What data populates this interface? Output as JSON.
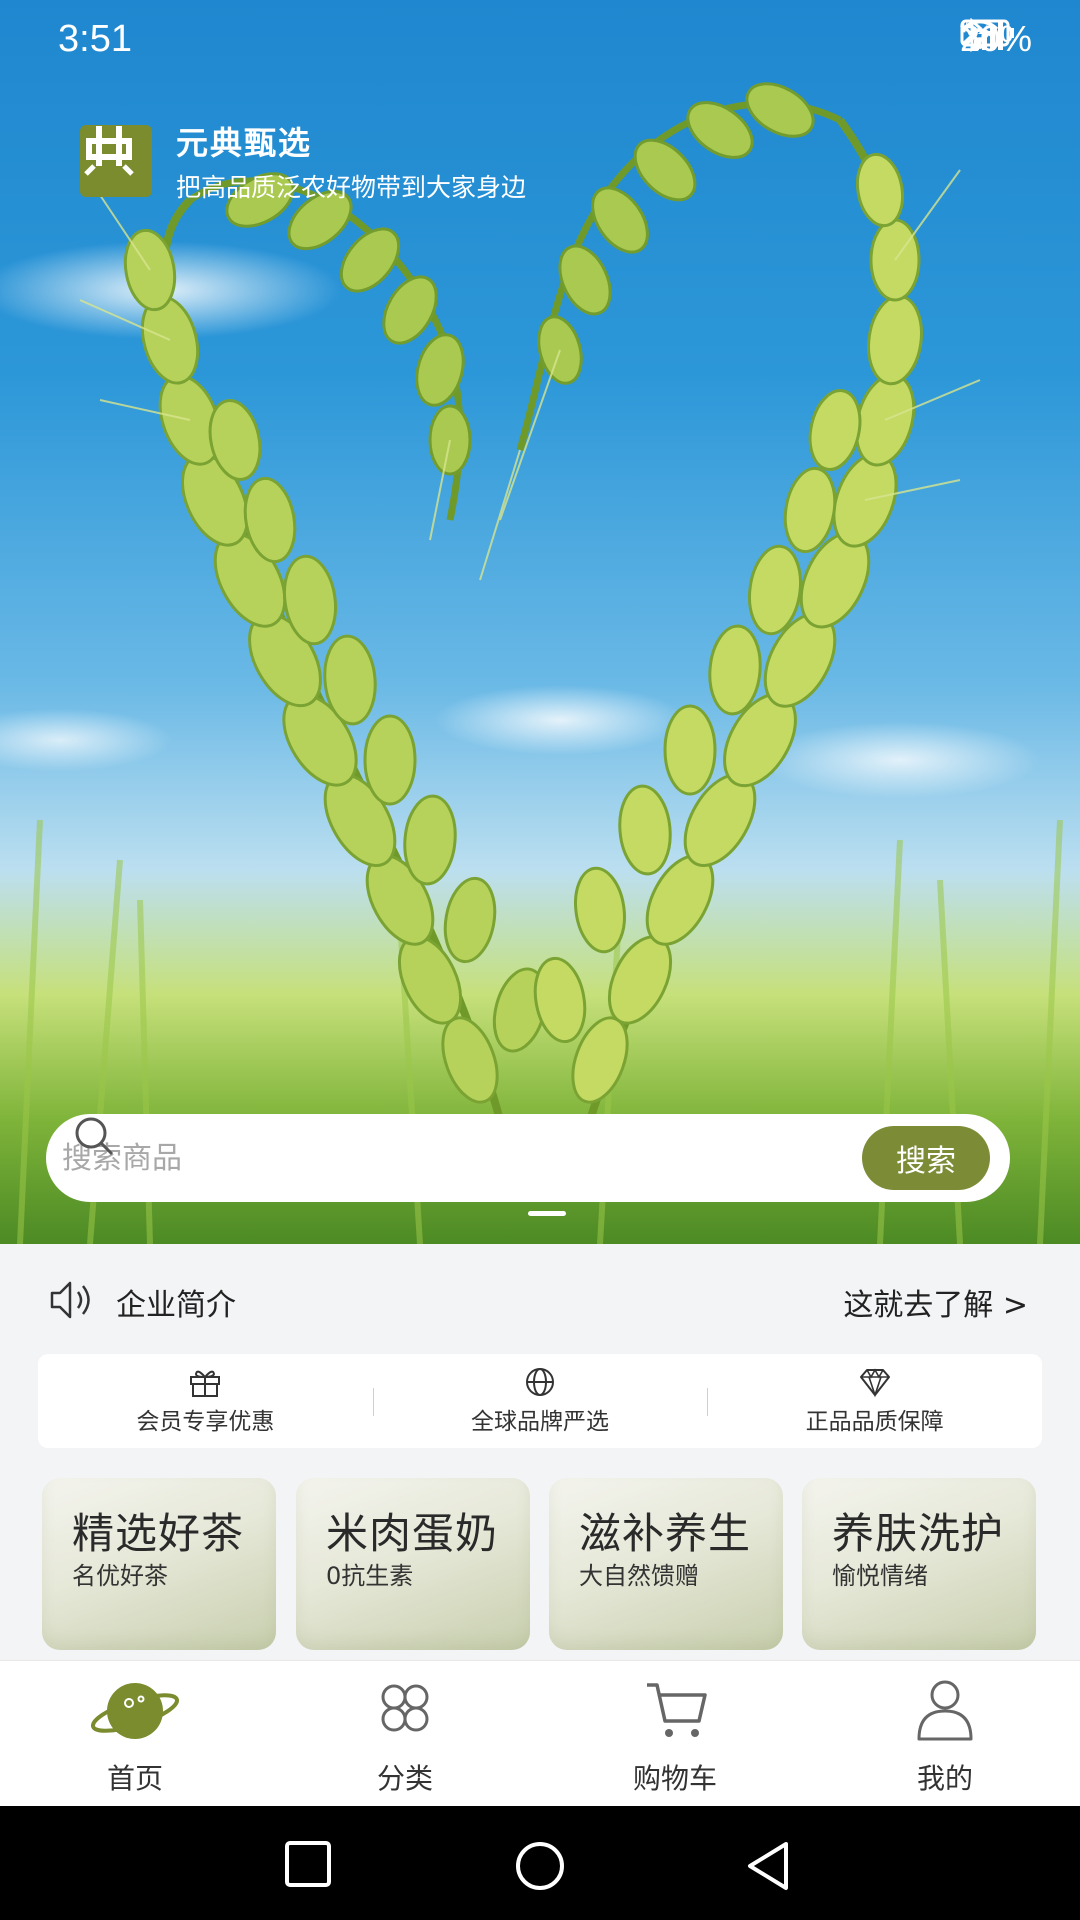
{
  "status_bar": {
    "time": "3:51",
    "battery": "20%",
    "icons": [
      "bluetooth-icon",
      "wifi-icon",
      "signal-4g-icon",
      "battery-charging-icon"
    ]
  },
  "brand": {
    "name": "元典甄选",
    "slogan": "把高品质泛农好物带到大家身边",
    "logo_icon": "brand-logo-icon",
    "logo_color": "#7a8c2e"
  },
  "search": {
    "placeholder": "搜索商品",
    "value": "",
    "button_label": "搜索",
    "button_color": "#7c8c36"
  },
  "carousel": {
    "active_index": 0
  },
  "notice": {
    "icon": "speaker-icon",
    "title": "企业简介",
    "link": "这就去了解 >"
  },
  "features": [
    {
      "icon": "gift-icon",
      "label": "会员专享优惠"
    },
    {
      "icon": "globe-icon",
      "label": "全球品牌严选"
    },
    {
      "icon": "diamond-icon",
      "label": "正品品质保障"
    }
  ],
  "categories": [
    {
      "title": "精选好茶",
      "subtitle": "名优好茶"
    },
    {
      "title": "米肉蛋奶",
      "subtitle": "0抗生素"
    },
    {
      "title": "滋补养生",
      "subtitle": "大自然馈赠"
    },
    {
      "title": "养肤洗护",
      "subtitle": "愉悦情绪"
    }
  ],
  "tabbar": {
    "accent": "#7a8c2e",
    "active": "home",
    "items": [
      {
        "id": "home",
        "label": "首页",
        "icon": "planet-icon"
      },
      {
        "id": "category",
        "label": "分类",
        "icon": "grid-icon"
      },
      {
        "id": "cart",
        "label": "购物车",
        "icon": "cart-icon"
      },
      {
        "id": "mine",
        "label": "我的",
        "icon": "user-icon"
      }
    ]
  },
  "system_nav": [
    "recent-apps-icon",
    "home-circle-icon",
    "back-triangle-icon"
  ]
}
